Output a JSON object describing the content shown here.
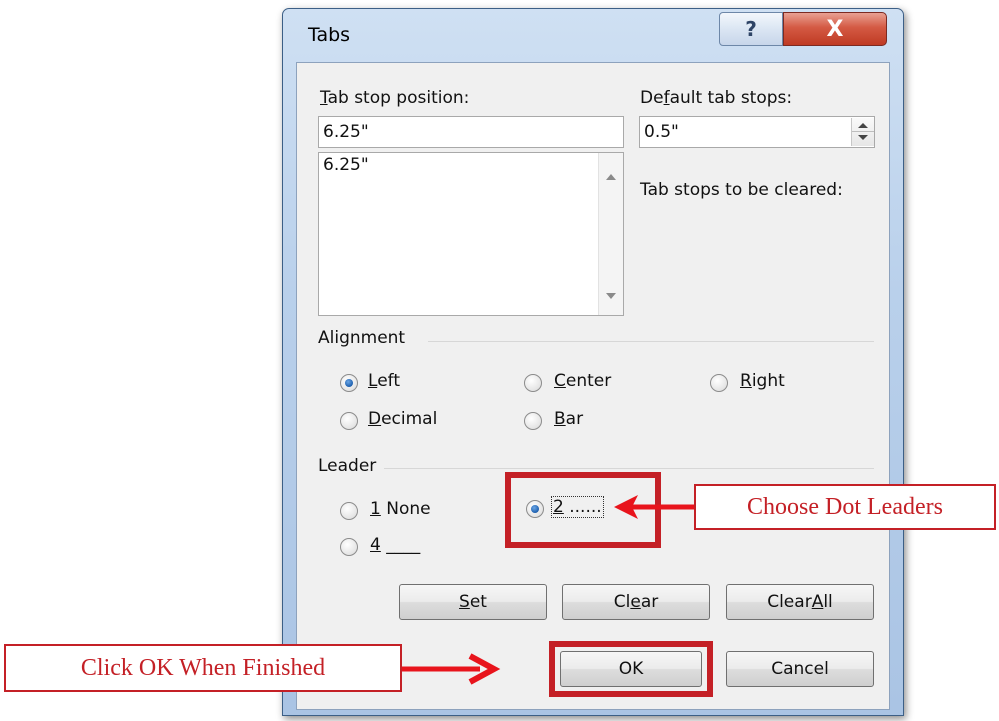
{
  "dialog": {
    "title": "Tabs",
    "help_glyph": "?",
    "close_glyph": "X"
  },
  "tab_stop": {
    "label_pre": "",
    "label_mn": "T",
    "label_post": "ab stop position:",
    "value": "6.25\"",
    "list": [
      "6.25\""
    ]
  },
  "default_tabs": {
    "label_pre": "De",
    "label_mn": "f",
    "label_post": "ault tab stops:",
    "value": "0.5\""
  },
  "cleared_label": "Tab stops to be cleared:",
  "alignment": {
    "title": "Alignment",
    "options": [
      {
        "mn": "L",
        "rest": "eft",
        "checked": true
      },
      {
        "mn": "C",
        "rest": "enter",
        "checked": false
      },
      {
        "mn": "R",
        "rest": "ight",
        "checked": false
      },
      {
        "mn": "D",
        "rest": "ecimal",
        "checked": false
      },
      {
        "mn": "B",
        "rest": "ar",
        "checked": false
      }
    ]
  },
  "leader": {
    "title": "Leader",
    "options": [
      {
        "mn": "1",
        "rest": " None",
        "checked": false
      },
      {
        "mn": "2",
        "rest": " ......",
        "checked": true
      },
      {
        "mn": "4",
        "rest": " ____",
        "checked": false
      }
    ]
  },
  "buttons": {
    "set": {
      "pre": "",
      "mn": "S",
      "post": "et"
    },
    "clear": {
      "pre": "Cl",
      "mn": "e",
      "post": "ar"
    },
    "clear_all": {
      "pre": "Clear ",
      "mn": "A",
      "post": "ll"
    },
    "ok": "OK",
    "cancel": "Cancel"
  },
  "annotations": {
    "dot_leaders": "Choose Dot Leaders",
    "click_ok": "Click OK When Finished",
    "color": "#c42026"
  }
}
